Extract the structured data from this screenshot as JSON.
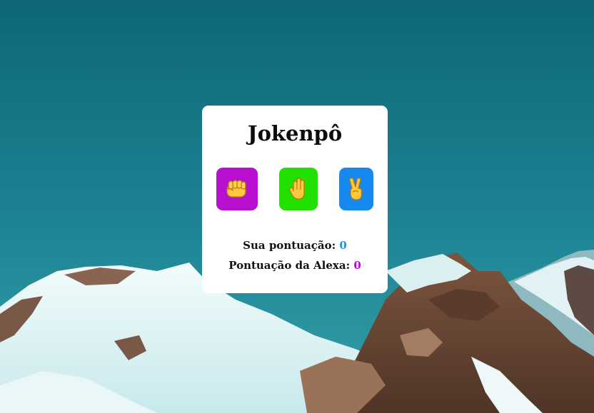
{
  "game": {
    "title": "Jokenpô",
    "choices": [
      {
        "name": "rock",
        "color": "#b90fd0",
        "icon": "fist-icon"
      },
      {
        "name": "paper",
        "color": "#22e000",
        "icon": "raised-hand-icon"
      },
      {
        "name": "scissors",
        "color": "#1589f0",
        "icon": "victory-hand-icon"
      }
    ],
    "scores": {
      "player_label": "Sua pontuação:",
      "player_value": "0",
      "player_color": "#2f8fdc",
      "alexa_label": "Pontuação da Alexa:",
      "alexa_value": "0",
      "alexa_color": "#b90fd0"
    }
  },
  "background": {
    "sky_top": "#0f6a7c",
    "sky_bottom": "#2c96a3",
    "snow": "#e6f6f7",
    "rock": "#6e4a36"
  }
}
